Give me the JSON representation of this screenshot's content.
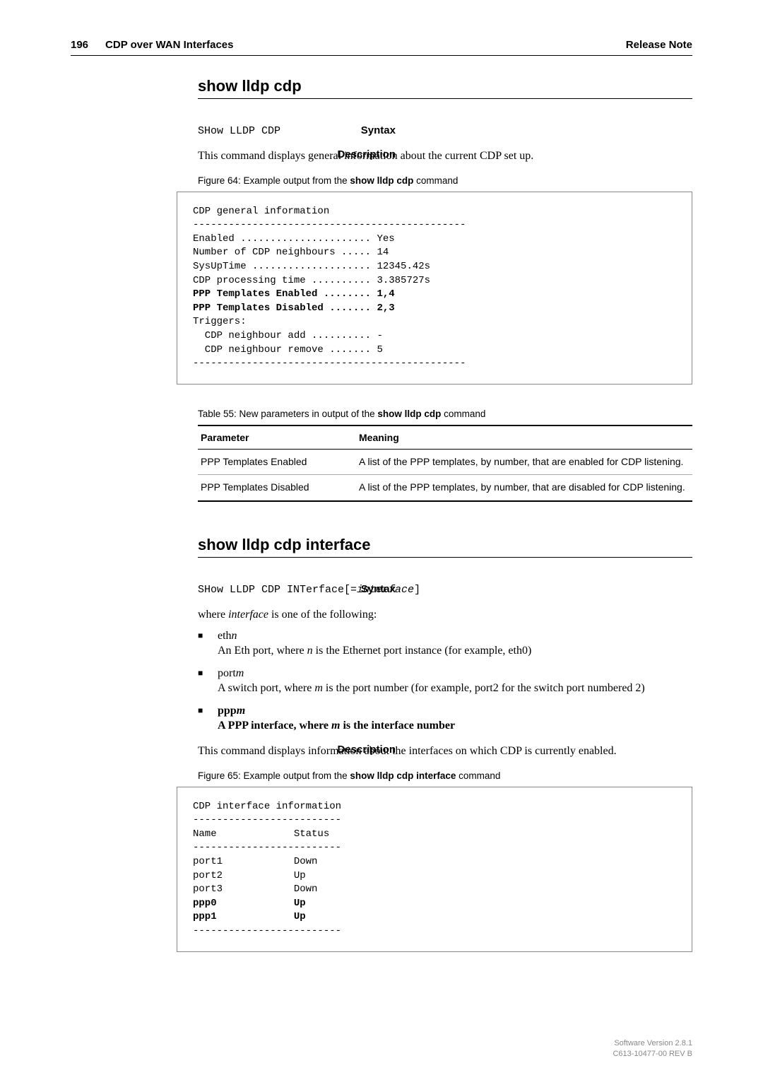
{
  "header": {
    "page_number": "196",
    "chapter": "CDP over WAN Interfaces",
    "right": "Release Note"
  },
  "s1": {
    "title": "show lldp cdp",
    "syntax_label": "Syntax",
    "syntax_text": "SHow LLDP CDP",
    "desc_label": "Description",
    "desc_text": "This command displays general information about the current CDP set up.",
    "fig_caption_pre": "Figure 64: Example output from the ",
    "fig_caption_bold": "show lldp cdp",
    "fig_caption_post": " command",
    "code": {
      "l1": "CDP general information",
      "l2": "----------------------------------------------",
      "l3": "Enabled ...................... Yes",
      "l4": "Number of CDP neighbours ..... 14",
      "l5": "SysUpTime .................... 12345.42s",
      "l6": "CDP processing time .......... 3.385727s",
      "l7": "PPP Templates Enabled ........ 1,4",
      "l8": "PPP Templates Disabled ....... 2,3",
      "l9": "Triggers:",
      "l10": "  CDP neighbour add .......... -",
      "l11": "  CDP neighbour remove ....... 5",
      "l12": "----------------------------------------------"
    },
    "table_caption_pre": "Table 55: New parameters in output of the ",
    "table_caption_bold": "show lldp cdp",
    "table_caption_post": " command",
    "th1": "Parameter",
    "th2": "Meaning",
    "rows": [
      {
        "p": "PPP Templates Enabled",
        "m": "A list of the PPP templates, by number, that are enabled for CDP listening."
      },
      {
        "p": "PPP Templates Disabled",
        "m": "A list of the PPP templates, by number, that are disabled for CDP listening."
      }
    ]
  },
  "s2": {
    "title": "show lldp cdp interface",
    "syntax_label": "Syntax",
    "syntax_text_pre": "SHow LLDP CDP INTerface[=",
    "syntax_text_em": "interface",
    "syntax_text_post": "]",
    "where_pre": "where ",
    "where_em": "interface",
    "where_post": " is one of the following:",
    "items": [
      {
        "head_pre": "eth",
        "head_em": "n",
        "desc_pre": "An Eth port, where ",
        "desc_em": "n",
        "desc_post": " is the Ethernet port instance (for example, eth0)",
        "bold": false
      },
      {
        "head_pre": "port",
        "head_em": "m",
        "desc_pre": "A switch port, where ",
        "desc_em": "m",
        "desc_post": " is the port number (for example, port2 for the switch port numbered 2)",
        "bold": false
      },
      {
        "head_pre": "ppp",
        "head_em": "m",
        "desc_pre": "A PPP interface, where ",
        "desc_em": "m",
        "desc_post": " is the interface number",
        "bold": true
      }
    ],
    "desc_label": "Description",
    "desc_text": "This command displays information about the interfaces on which CDP is currently enabled.",
    "fig_caption_pre": "Figure 65: Example output from the ",
    "fig_caption_bold": "show lldp cdp interface",
    "fig_caption_post": " command",
    "code": {
      "l1": "CDP interface information",
      "l2": "-------------------------",
      "l3": "Name             Status",
      "l4": "-------------------------",
      "l5": "port1            Down",
      "l6": "port2            Up",
      "l7": "port3            Down",
      "l8": "ppp0             Up",
      "l9": "ppp1             Up",
      "l10": "-------------------------"
    }
  },
  "footer": {
    "l1": "Software Version 2.8.1",
    "l2": "C613-10477-00 REV B"
  }
}
